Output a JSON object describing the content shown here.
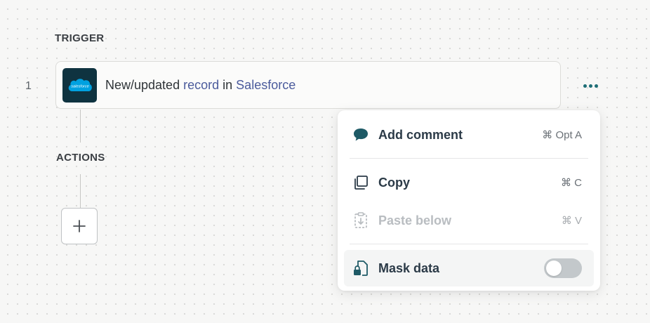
{
  "trigger": {
    "section_label": "TRIGGER",
    "step_number": "1",
    "app_logo_text": "salesforce",
    "text_prefix": "New/updated",
    "text_record": "record",
    "text_in": "in",
    "text_app": "Salesforce"
  },
  "actions": {
    "section_label": "ACTIONS"
  },
  "context_menu": {
    "items": [
      {
        "label": "Add comment",
        "shortcut": "⌘ Opt A",
        "icon": "comment-icon",
        "enabled": true
      },
      {
        "label": "Copy",
        "shortcut": "⌘ C",
        "icon": "copy-icon",
        "enabled": true
      },
      {
        "label": "Paste below",
        "shortcut": "⌘ V",
        "icon": "paste-icon",
        "enabled": false
      },
      {
        "label": "Mask data",
        "icon": "lock-document-icon",
        "enabled": true,
        "toggle_on": false
      }
    ]
  },
  "colors": {
    "accent_teal": "#1e6e76",
    "link_blue": "#4b5b9c",
    "salesforce_bg": "#0f3340",
    "salesforce_cloud": "#00a1e0"
  }
}
